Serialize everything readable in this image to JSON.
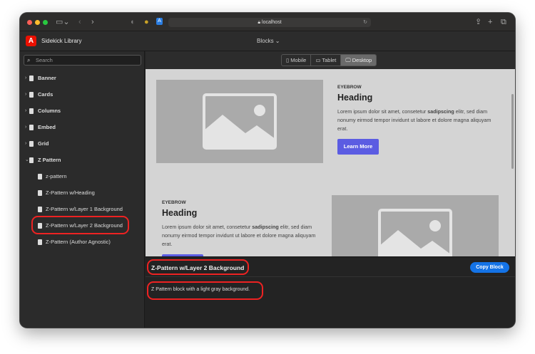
{
  "browser": {
    "url": "localhost"
  },
  "app": {
    "title": "Sidekick Library",
    "blocks_menu": "Blocks"
  },
  "sidebar": {
    "search_placeholder": "Search",
    "groups": [
      {
        "label": "Banner"
      },
      {
        "label": "Cards"
      },
      {
        "label": "Columns"
      },
      {
        "label": "Embed"
      },
      {
        "label": "Grid"
      },
      {
        "label": "Z Pattern",
        "expanded": true
      }
    ],
    "children": [
      {
        "label": "z-pattern"
      },
      {
        "label": "Z-Pattern w/Heading"
      },
      {
        "label": "Z-Pattern w/Layer 1 Background"
      },
      {
        "label": "Z-Pattern w/Layer 2 Background",
        "selected": true
      },
      {
        "label": "Z-Pattern (Author Agnostic)"
      }
    ]
  },
  "toolbar": {
    "views": [
      {
        "label": "Mobile",
        "icon": "phone-icon"
      },
      {
        "label": "Tablet",
        "icon": "tablet-icon"
      },
      {
        "label": "Desktop",
        "icon": "desktop-icon",
        "active": true
      }
    ]
  },
  "preview": {
    "rows": [
      {
        "eyebrow": "EYEBROW",
        "heading": "Heading",
        "body_before": "Lorem ipsum dolor sit amet, consetetur ",
        "body_bold": "sadipscing",
        "body_after": " elitr, sed diam nonumy eirmod tempor invidunt ut labore et dolore magna aliquyam erat.",
        "button": "Learn More"
      },
      {
        "eyebrow": "EYEBROW",
        "heading": "Heading",
        "body_before": "Lorem ipsum dolor sit amet, consetetur ",
        "body_bold": "sadipscing",
        "body_after": " elitr, sed diam nonumy eirmod tempor invidunt ut labore et dolore magna aliquyam erat."
      }
    ]
  },
  "details": {
    "title": "Z-Pattern w/Layer 2 Background",
    "copy_button": "Copy Block",
    "description": "Z Pattern block with a light gray background."
  },
  "colors": {
    "accent": "#1473e6",
    "button": "#5b5ce2",
    "highlight": "#e22222"
  }
}
